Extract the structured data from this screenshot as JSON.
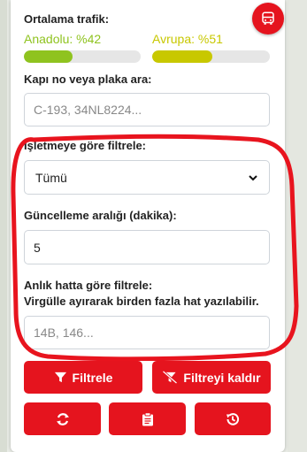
{
  "traffic": {
    "title": "Ortalama trafik:",
    "anatolia_label": "Anadolu: %42",
    "europe_label": "Avrupa: %51",
    "anatolia_value": 42,
    "europe_value": 51,
    "anatolia_color": "#8fc31f",
    "europe_color": "#c8c800"
  },
  "search": {
    "label": "Kapı no veya plaka ara:",
    "placeholder": "C-193, 34NL8224..."
  },
  "operator_filter": {
    "label": "İşletmeye göre filtrele:",
    "selected": "Tümü"
  },
  "interval": {
    "label": "Güncelleme aralığı (dakika):",
    "value": "5"
  },
  "line_filter": {
    "label": "Anlık hatta göre filtrele:",
    "hint": "Virgülle ayırarak birden fazla hat yazılabilir.",
    "placeholder": "14B, 146..."
  },
  "buttons": {
    "filter": "Filtrele",
    "clear_filter": "Filtreyi kaldır"
  },
  "icons": {
    "fab": "bus-icon",
    "filter": "filter-icon",
    "clear_filter": "filter-off-icon",
    "refresh": "refresh-icon",
    "clipboard": "clipboard-icon",
    "history": "history-icon"
  },
  "colors": {
    "accent": "#e5141e",
    "annotation": "#e8141e"
  }
}
